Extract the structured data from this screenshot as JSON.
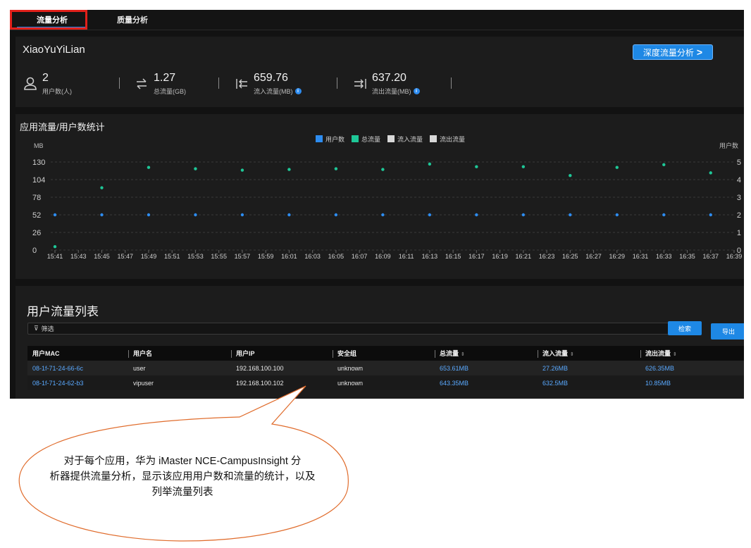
{
  "tabs": [
    {
      "label": "流量分析",
      "active": true
    },
    {
      "label": "质量分析",
      "active": false
    }
  ],
  "header": {
    "title": "XiaoYuYiLian",
    "deep_button": "深度流量分析",
    "stats": [
      {
        "value": "2",
        "label": "用户数(人)",
        "icon": "user-icon"
      },
      {
        "value": "1.27",
        "label": "总流量(GB)",
        "icon": "swap-icon"
      },
      {
        "value": "659.76",
        "label": "流入流量(MB)",
        "icon": "inflow-icon",
        "info": true
      },
      {
        "value": "637.20",
        "label": "流出流量(MB)",
        "icon": "outflow-icon",
        "info": true
      }
    ]
  },
  "chart_data": {
    "type": "scatter",
    "title": "应用流量/用户数统计",
    "ylabel": "MB",
    "y2label": "用户数",
    "legend": [
      "用户数",
      "总流量",
      "流入流量",
      "流出流量"
    ],
    "legend_colors": [
      "#2d8cf0",
      "#1ec797",
      "#d8d8d8",
      "#d8d8d8"
    ],
    "ylim": [
      0,
      130
    ],
    "y_ticks": [
      0,
      26,
      52,
      78,
      104,
      130
    ],
    "y2lim": [
      0,
      5
    ],
    "y2_ticks": [
      0,
      1,
      2,
      3,
      4,
      5
    ],
    "x_ticks": [
      "15:41",
      "15:43",
      "15:45",
      "15:47",
      "15:49",
      "15:51",
      "15:53",
      "15:55",
      "15:57",
      "15:59",
      "16:01",
      "16:03",
      "16:05",
      "16:07",
      "16:09",
      "16:11",
      "16:13",
      "16:15",
      "16:17",
      "16:19",
      "16:21",
      "16:23",
      "16:25",
      "16:27",
      "16:29",
      "16:31",
      "16:33",
      "16:35",
      "16:37",
      "16:39"
    ],
    "series": [
      {
        "name": "用户数",
        "axis": "right",
        "color": "#2d8cf0",
        "x": [
          "15:41",
          "15:45",
          "15:49",
          "15:53",
          "15:57",
          "16:01",
          "16:05",
          "16:09",
          "16:13",
          "16:17",
          "16:21",
          "16:25",
          "16:29",
          "16:33",
          "16:37"
        ],
        "values": [
          2,
          2,
          2,
          2,
          2,
          2,
          2,
          2,
          2,
          2,
          2,
          2,
          2,
          2,
          2
        ]
      },
      {
        "name": "总流量",
        "axis": "left",
        "color": "#1ec797",
        "x": [
          "15:41",
          "15:45",
          "15:49",
          "15:53",
          "15:57",
          "16:01",
          "16:05",
          "16:09",
          "16:13",
          "16:17",
          "16:21",
          "16:25",
          "16:29",
          "16:33",
          "16:37"
        ],
        "values": [
          5,
          92,
          122,
          120,
          118,
          119,
          120,
          119,
          127,
          123,
          123,
          110,
          122,
          126,
          114
        ]
      }
    ]
  },
  "list": {
    "title": "用户流量列表",
    "filter_label": "筛选",
    "search_button": "检索",
    "export_button": "导出",
    "columns": [
      {
        "label": "用户MAC",
        "sortable": false
      },
      {
        "label": "用户名",
        "sortable": false
      },
      {
        "label": "用户IP",
        "sortable": false
      },
      {
        "label": "安全组",
        "sortable": false
      },
      {
        "label": "总流量",
        "sortable": true
      },
      {
        "label": "流入流量",
        "sortable": true
      },
      {
        "label": "流出流量",
        "sortable": true
      }
    ],
    "rows": [
      [
        "08-1f-71-24-66-6c",
        "user",
        "192.168.100.100",
        "unknown",
        "653.61MB",
        "27.26MB",
        "626.35MB"
      ],
      [
        "08-1f-71-24-62-b3",
        "vipuser",
        "192.168.100.102",
        "unknown",
        "643.35MB",
        "632.5MB",
        "10.85MB"
      ]
    ]
  },
  "annotation": {
    "text_line1": "对于每个应用，华为 iMaster NCE-CampusInsight 分",
    "text_line2": "析器提供流量分析，显示该应用用户数和流量的统计，以及",
    "text_line3": "列举流量列表",
    "color": "#e06c2c"
  }
}
